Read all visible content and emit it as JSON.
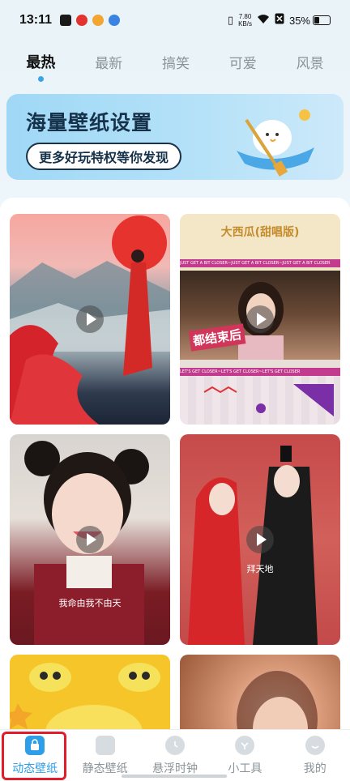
{
  "status_bar": {
    "time": "13:11",
    "net_speed_value": "7.80",
    "net_speed_unit": "KB/s",
    "battery_percent": "35%",
    "battery_level": 0.35
  },
  "tabs": [
    {
      "label": "最热",
      "active": true
    },
    {
      "label": "最新",
      "active": false
    },
    {
      "label": "搞笑",
      "active": false
    },
    {
      "label": "可爱",
      "active": false
    },
    {
      "label": "风景",
      "active": false
    }
  ],
  "banner": {
    "title": "海量壁纸设置",
    "button_label": "更多好玩特权等你发现"
  },
  "tiles": [
    {
      "kind": "video",
      "icon": "play-icon"
    },
    {
      "kind": "video",
      "icon": "play-icon",
      "head_text": "大西瓜(甜唱版)",
      "overlay_text": "都结束后",
      "strip_text": "JUST GET A BIT CLOSER~JUST GET A BIT CLOSER~JUST GET A BIT CLOSER",
      "strip_text_2": "LET'S GET CLOSER~LET'S GET CLOSER~LET'S GET CLOSER"
    },
    {
      "kind": "video",
      "icon": "play-icon",
      "caption": "我命由我不由天"
    },
    {
      "kind": "video",
      "icon": "play-icon",
      "caption": "拜天地"
    },
    {
      "kind": "video",
      "icon": "play-icon"
    },
    {
      "kind": "video",
      "icon": "play-icon"
    }
  ],
  "bottom_nav": [
    {
      "label": "动态壁纸",
      "icon": "lock-icon",
      "active": true
    },
    {
      "label": "静态壁纸",
      "icon": "image-icon",
      "active": false
    },
    {
      "label": "悬浮时钟",
      "icon": "clock-icon",
      "active": false
    },
    {
      "label": "小工具",
      "icon": "tool-icon",
      "active": false
    },
    {
      "label": "我的",
      "icon": "smile-icon",
      "active": false
    }
  ],
  "colors": {
    "accent": "#2e9ee8",
    "highlight_box": "#e11d2b",
    "banner_bg": "#9fd8f6"
  }
}
